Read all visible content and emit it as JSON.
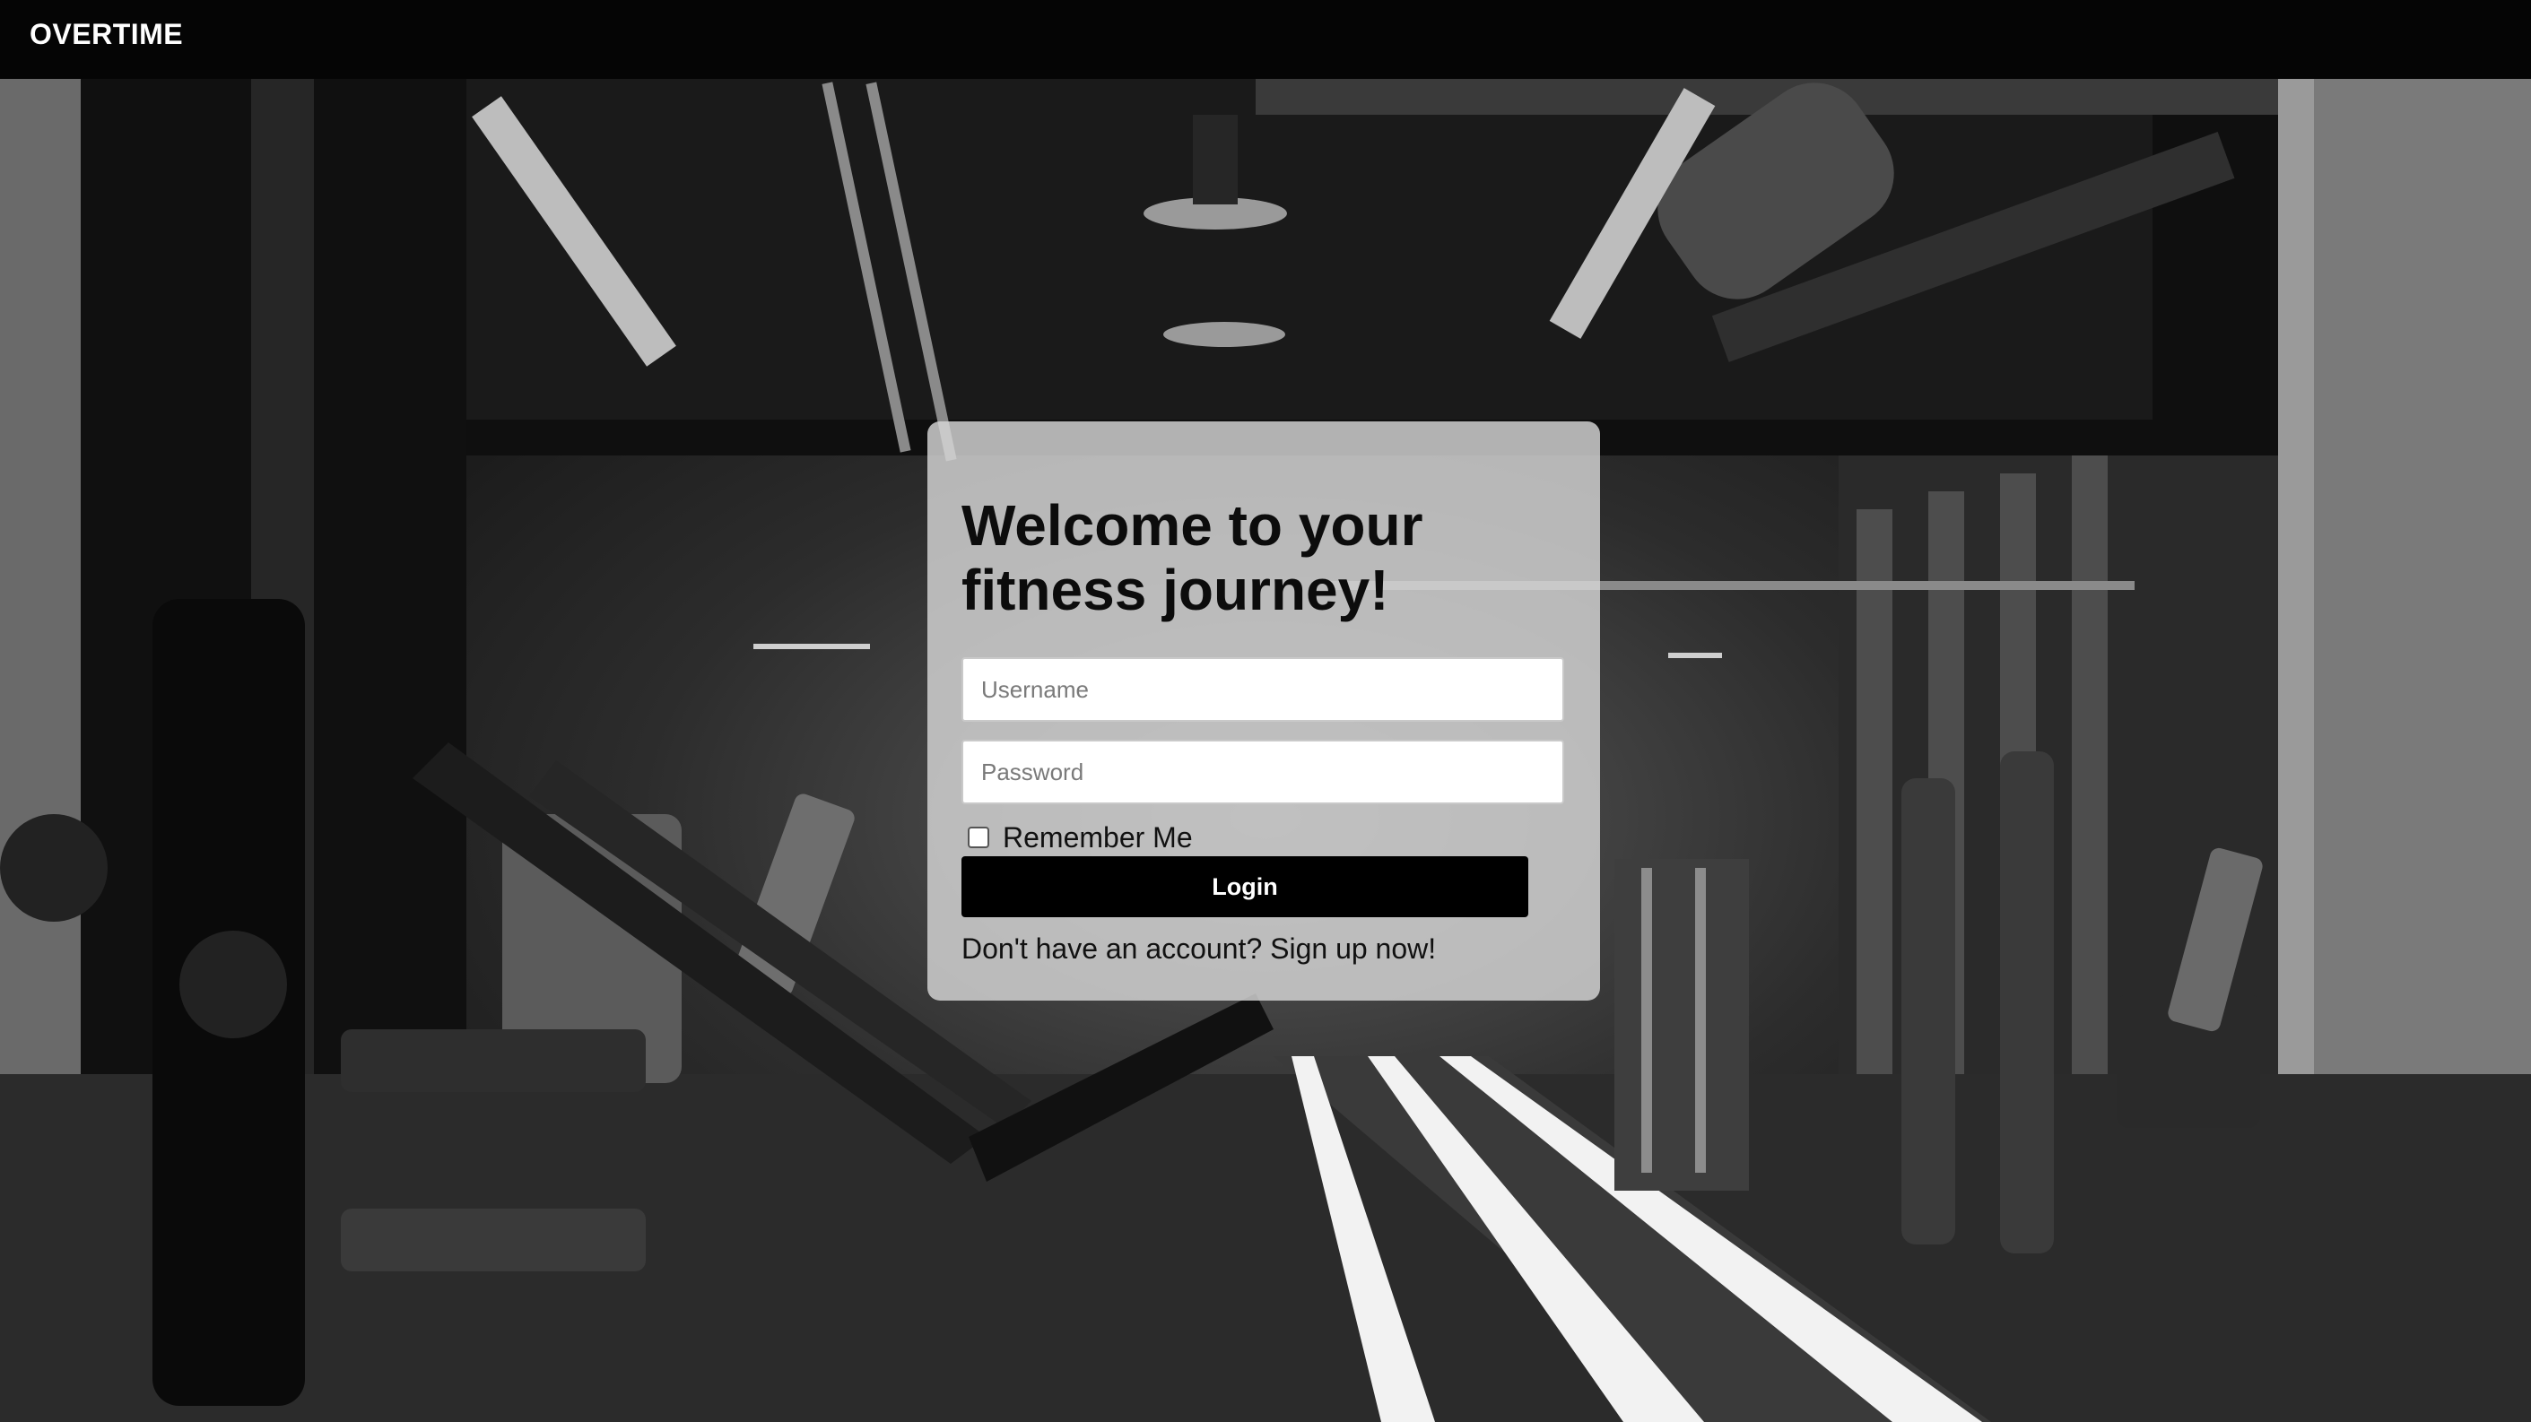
{
  "header": {
    "brand": "OVERTIME"
  },
  "login_card": {
    "title": "Welcome to your fitness journey!",
    "username_placeholder": "Username",
    "password_placeholder": "Password",
    "remember_label": "Remember Me",
    "remember_checked": false,
    "login_label": "Login",
    "signup_prompt": "Don't have an account? Sign up now!"
  },
  "colors": {
    "topbar": "#050505",
    "card": "#d7d7d7",
    "button": "#000000",
    "button_text": "#ffffff"
  }
}
